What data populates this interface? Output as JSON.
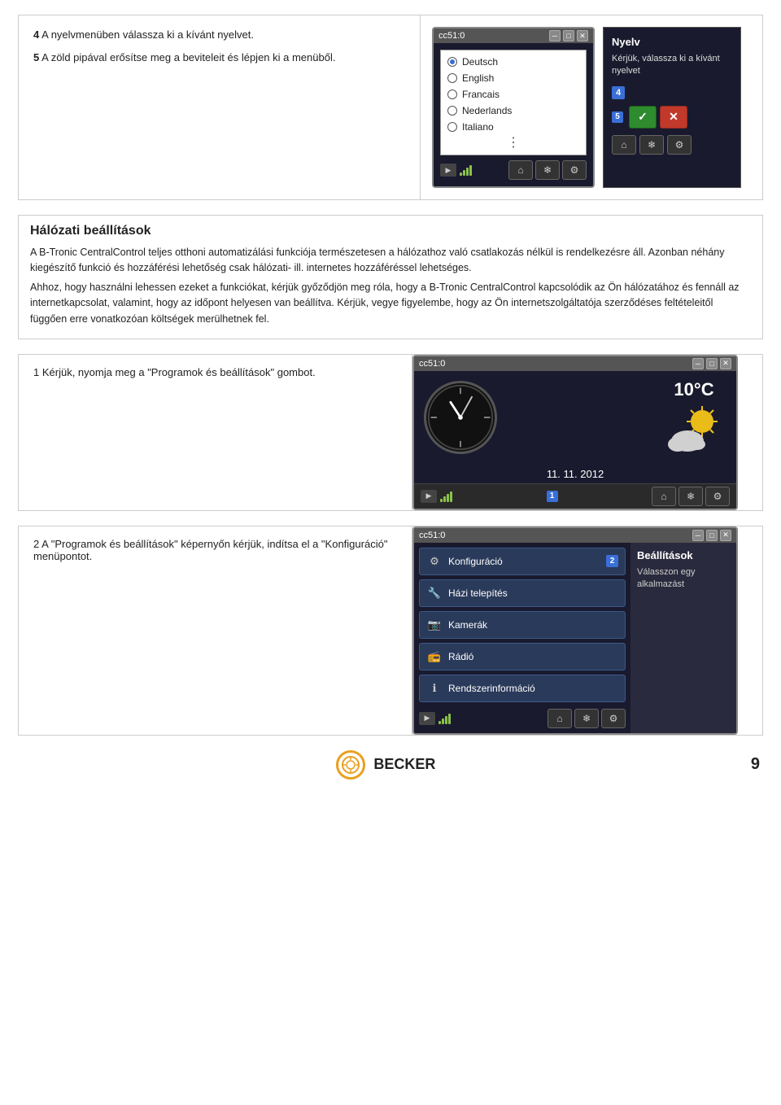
{
  "page": {
    "number": "9"
  },
  "top_section": {
    "step4_label": "4",
    "step4_text": "A nyelvmenüben válassza ki a kívánt nyelvet.",
    "step5_label": "5",
    "step5_text": "A zöld pipával erősítse meg a beviteleit és lépjen ki a menüből."
  },
  "cc51_lang": {
    "title": "cc51:0",
    "languages": [
      {
        "id": "deutsch",
        "label": "Deutsch",
        "selected": true
      },
      {
        "id": "english",
        "label": "English",
        "selected": false
      },
      {
        "id": "francais",
        "label": "Francais",
        "selected": false
      },
      {
        "id": "nederlands",
        "label": "Nederlands",
        "selected": false
      },
      {
        "id": "italiano",
        "label": "Italiano",
        "selected": false
      }
    ],
    "more_dots": "⋮"
  },
  "nyelv_panel": {
    "title": "Nyelv",
    "description": "Kérjük, válassza ki a kívánt nyelvet",
    "step_badge": "5",
    "confirm_btn": "✓",
    "cancel_btn": "✕"
  },
  "bottom_icons": [
    "⌂",
    "❄",
    "⚙"
  ],
  "middle_section": {
    "title": "Hálózati beállítások",
    "para1": "A B-Tronic CentralControl teljes otthoni automatizálási funkciója természetesen a hálózathoz való csatlakozás nélkül is rendelkezésre áll. Azonban néhány kiegészítő funkció és hozzáférési lehetőség csak hálózati- ill. internetes hozzáféréssel lehetséges.",
    "para2": "Ahhoz, hogy használni lehessen ezeket a funkciókat, kérjük győződjön meg róla, hogy a B-Tronic CentralControl kapcsolódik az Ön hálózatához és fennáll az internetkapcsolat, valamint, hogy az időpont helyesen van beállítva. Kérjük, vegye figyelembe, hogy az Ön internetszolgáltatója szerződéses feltételeitől függően erre vonatkozóan költségek merülhetnek fel."
  },
  "bottom_row1": {
    "step1_label": "1",
    "step1_text": "Kérjük, nyomja meg a \"Programok és beállítások\" gombot.",
    "clock_screen": {
      "title": "cc51:0",
      "temperature": "10°C",
      "date": "11. 11. 2012"
    }
  },
  "bottom_row2": {
    "step2_label": "2",
    "step2_text": "A \"Programok és beállítások\" képernyőn kérjük, indítsa el a \"Konfiguráció\" menüpontot.",
    "config_screen": {
      "title": "cc51:0",
      "menu_items": [
        {
          "id": "konfig",
          "label": "Konfiguráció",
          "icon": "⚙",
          "badge": "2"
        },
        {
          "id": "hazi",
          "label": "Házi telepítés",
          "icon": "🔧",
          "badge": ""
        },
        {
          "id": "kamerak",
          "label": "Kamerák",
          "icon": "📷",
          "badge": ""
        },
        {
          "id": "radio",
          "label": "Rádió",
          "icon": "📻",
          "badge": ""
        },
        {
          "id": "rendszer",
          "label": "Rendszerinformáció",
          "icon": "ℹ",
          "badge": ""
        }
      ],
      "right_panel_title": "Beállítások",
      "right_panel_desc": "Válasszon egy alkalmazást"
    }
  },
  "becker": {
    "logo_text": "BECKER"
  }
}
